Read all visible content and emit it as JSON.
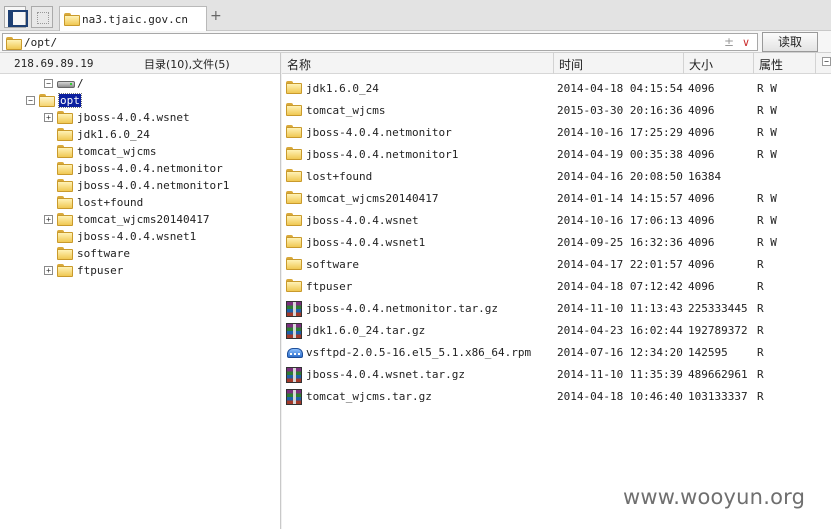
{
  "tabbar": {
    "tab_title": "na3.tjaic.gov.cn",
    "add_symbol": "+"
  },
  "pathbar": {
    "path": "/opt/",
    "pm_symbol": "±",
    "chevron_symbol": "∨",
    "read_label": "读取"
  },
  "left": {
    "ip": "218.69.89.19",
    "summary": "目录(10),文件(5)",
    "tree": [
      {
        "label": "/",
        "expander": "−",
        "icon": "drive-icon"
      },
      {
        "label": "opt",
        "expander": "−",
        "icon": "open-folder-icon",
        "selected": true
      },
      {
        "label": "jboss-4.0.4.wsnet",
        "expander": "+",
        "icon": "folder-icon"
      },
      {
        "label": "jdk1.6.0_24",
        "expander": "",
        "icon": "folder-icon"
      },
      {
        "label": "tomcat_wjcms",
        "expander": "",
        "icon": "folder-icon"
      },
      {
        "label": "jboss-4.0.4.netmonitor",
        "expander": "",
        "icon": "folder-icon"
      },
      {
        "label": "jboss-4.0.4.netmonitor1",
        "expander": "",
        "icon": "folder-icon"
      },
      {
        "label": "lost+found",
        "expander": "",
        "icon": "folder-icon"
      },
      {
        "label": "tomcat_wjcms20140417",
        "expander": "+",
        "icon": "folder-icon"
      },
      {
        "label": "jboss-4.0.4.wsnet1",
        "expander": "",
        "icon": "folder-icon"
      },
      {
        "label": "software",
        "expander": "",
        "icon": "folder-icon"
      },
      {
        "label": "ftpuser",
        "expander": "+",
        "icon": "folder-icon"
      }
    ]
  },
  "right": {
    "columns": [
      "名称",
      "时间",
      "大小",
      "属性"
    ],
    "collapse_symbol": "−",
    "rows": [
      {
        "icon": "folder-icon",
        "name": "jdk1.6.0_24",
        "time": "2014-04-18 04:15:54",
        "size": "4096",
        "attr": "R W"
      },
      {
        "icon": "folder-icon",
        "name": "tomcat_wjcms",
        "time": "2015-03-30 20:16:36",
        "size": "4096",
        "attr": "R W"
      },
      {
        "icon": "folder-icon",
        "name": "jboss-4.0.4.netmonitor",
        "time": "2014-10-16 17:25:29",
        "size": "4096",
        "attr": "R W"
      },
      {
        "icon": "folder-icon",
        "name": "jboss-4.0.4.netmonitor1",
        "time": "2014-04-19 00:35:38",
        "size": "4096",
        "attr": "R W"
      },
      {
        "icon": "folder-icon",
        "name": "lost+found",
        "time": "2014-04-16 20:08:50",
        "size": "16384",
        "attr": ""
      },
      {
        "icon": "folder-icon",
        "name": "tomcat_wjcms20140417",
        "time": "2014-01-14 14:15:57",
        "size": "4096",
        "attr": "R W"
      },
      {
        "icon": "folder-icon",
        "name": "jboss-4.0.4.wsnet",
        "time": "2014-10-16 17:06:13",
        "size": "4096",
        "attr": "R W"
      },
      {
        "icon": "folder-icon",
        "name": "jboss-4.0.4.wsnet1",
        "time": "2014-09-25 16:32:36",
        "size": "4096",
        "attr": "R W"
      },
      {
        "icon": "folder-icon",
        "name": "software",
        "time": "2014-04-17 22:01:57",
        "size": "4096",
        "attr": "R"
      },
      {
        "icon": "folder-icon",
        "name": "ftpuser",
        "time": "2014-04-18 07:12:42",
        "size": "4096",
        "attr": "R"
      },
      {
        "icon": "archive-icon",
        "name": "jboss-4.0.4.netmonitor.tar.gz",
        "time": "2014-11-10 11:13:43",
        "size": "225333445",
        "attr": "R"
      },
      {
        "icon": "archive-icon",
        "name": "jdk1.6.0_24.tar.gz",
        "time": "2014-04-23 16:02:44",
        "size": "192789372",
        "attr": "R"
      },
      {
        "icon": "rpm-package-icon",
        "name": "vsftpd-2.0.5-16.el5_5.1.x86_64.rpm",
        "time": "2014-07-16 12:34:20",
        "size": "142595",
        "attr": "R"
      },
      {
        "icon": "archive-icon",
        "name": "jboss-4.0.4.wsnet.tar.gz",
        "time": "2014-11-10 11:35:39",
        "size": "489662961",
        "attr": "R"
      },
      {
        "icon": "archive-icon",
        "name": "tomcat_wjcms.tar.gz",
        "time": "2014-04-18 10:46:40",
        "size": "103133337",
        "attr": "R"
      }
    ]
  },
  "watermark": "www.wooyun.org"
}
